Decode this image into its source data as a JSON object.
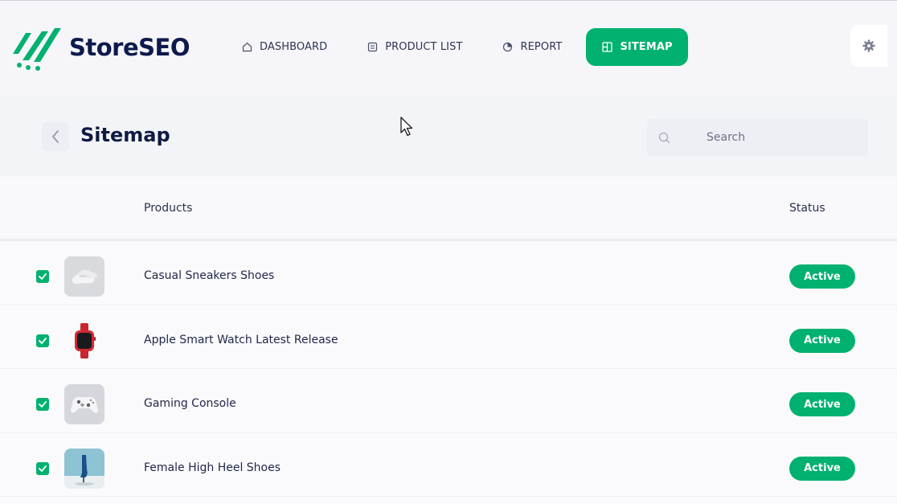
{
  "brand": {
    "name": "StoreSEO",
    "accent": "#00b16f",
    "logo_color": "#0e1a4d"
  },
  "nav": {
    "items": [
      {
        "label": "DASHBOARD",
        "icon": "home-icon",
        "active": false
      },
      {
        "label": "PRODUCT LIST",
        "icon": "list-icon",
        "active": false
      },
      {
        "label": "REPORT",
        "icon": "report-icon",
        "active": false
      },
      {
        "label": "SITEMAP",
        "icon": "sitemap-icon",
        "active": true
      }
    ],
    "settings_icon": "gear-icon"
  },
  "page": {
    "title": "Sitemap",
    "back_icon": "chevron-left-icon",
    "search": {
      "placeholder": "Search",
      "value": "",
      "icon": "search-icon"
    }
  },
  "table": {
    "columns": {
      "products": "Products",
      "status": "Status"
    },
    "rows": [
      {
        "checked": true,
        "thumbnail": "sneakers-thumbnail",
        "name": "Casual Sneakers Shoes",
        "status": "Active"
      },
      {
        "checked": true,
        "thumbnail": "smart-watch-thumbnail",
        "name": "Apple Smart Watch Latest Release",
        "status": "Active"
      },
      {
        "checked": true,
        "thumbnail": "gaming-controller-thumbnail",
        "name": "Gaming Console",
        "status": "Active"
      },
      {
        "checked": true,
        "thumbnail": "high-heel-thumbnail",
        "name": "Female High Heel Shoes",
        "status": "Active"
      }
    ]
  }
}
